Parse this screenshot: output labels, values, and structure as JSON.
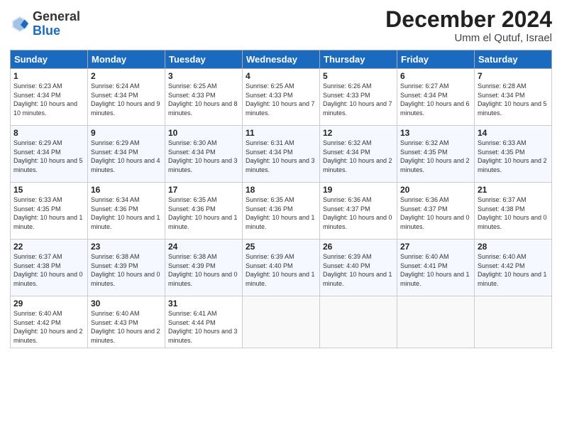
{
  "header": {
    "logo_general": "General",
    "logo_blue": "Blue",
    "month_title": "December 2024",
    "location": "Umm el Qutuf, Israel"
  },
  "days_of_week": [
    "Sunday",
    "Monday",
    "Tuesday",
    "Wednesday",
    "Thursday",
    "Friday",
    "Saturday"
  ],
  "weeks": [
    [
      {
        "day": "1",
        "sunrise": "6:23 AM",
        "sunset": "4:34 PM",
        "daylight": "10 hours and 10 minutes."
      },
      {
        "day": "2",
        "sunrise": "6:24 AM",
        "sunset": "4:34 PM",
        "daylight": "10 hours and 9 minutes."
      },
      {
        "day": "3",
        "sunrise": "6:25 AM",
        "sunset": "4:33 PM",
        "daylight": "10 hours and 8 minutes."
      },
      {
        "day": "4",
        "sunrise": "6:25 AM",
        "sunset": "4:33 PM",
        "daylight": "10 hours and 7 minutes."
      },
      {
        "day": "5",
        "sunrise": "6:26 AM",
        "sunset": "4:33 PM",
        "daylight": "10 hours and 7 minutes."
      },
      {
        "day": "6",
        "sunrise": "6:27 AM",
        "sunset": "4:34 PM",
        "daylight": "10 hours and 6 minutes."
      },
      {
        "day": "7",
        "sunrise": "6:28 AM",
        "sunset": "4:34 PM",
        "daylight": "10 hours and 5 minutes."
      }
    ],
    [
      {
        "day": "8",
        "sunrise": "6:29 AM",
        "sunset": "4:34 PM",
        "daylight": "10 hours and 5 minutes."
      },
      {
        "day": "9",
        "sunrise": "6:29 AM",
        "sunset": "4:34 PM",
        "daylight": "10 hours and 4 minutes."
      },
      {
        "day": "10",
        "sunrise": "6:30 AM",
        "sunset": "4:34 PM",
        "daylight": "10 hours and 3 minutes."
      },
      {
        "day": "11",
        "sunrise": "6:31 AM",
        "sunset": "4:34 PM",
        "daylight": "10 hours and 3 minutes."
      },
      {
        "day": "12",
        "sunrise": "6:32 AM",
        "sunset": "4:34 PM",
        "daylight": "10 hours and 2 minutes."
      },
      {
        "day": "13",
        "sunrise": "6:32 AM",
        "sunset": "4:35 PM",
        "daylight": "10 hours and 2 minutes."
      },
      {
        "day": "14",
        "sunrise": "6:33 AM",
        "sunset": "4:35 PM",
        "daylight": "10 hours and 2 minutes."
      }
    ],
    [
      {
        "day": "15",
        "sunrise": "6:33 AM",
        "sunset": "4:35 PM",
        "daylight": "10 hours and 1 minute."
      },
      {
        "day": "16",
        "sunrise": "6:34 AM",
        "sunset": "4:36 PM",
        "daylight": "10 hours and 1 minute."
      },
      {
        "day": "17",
        "sunrise": "6:35 AM",
        "sunset": "4:36 PM",
        "daylight": "10 hours and 1 minute."
      },
      {
        "day": "18",
        "sunrise": "6:35 AM",
        "sunset": "4:36 PM",
        "daylight": "10 hours and 1 minute."
      },
      {
        "day": "19",
        "sunrise": "6:36 AM",
        "sunset": "4:37 PM",
        "daylight": "10 hours and 0 minutes."
      },
      {
        "day": "20",
        "sunrise": "6:36 AM",
        "sunset": "4:37 PM",
        "daylight": "10 hours and 0 minutes."
      },
      {
        "day": "21",
        "sunrise": "6:37 AM",
        "sunset": "4:38 PM",
        "daylight": "10 hours and 0 minutes."
      }
    ],
    [
      {
        "day": "22",
        "sunrise": "6:37 AM",
        "sunset": "4:38 PM",
        "daylight": "10 hours and 0 minutes."
      },
      {
        "day": "23",
        "sunrise": "6:38 AM",
        "sunset": "4:39 PM",
        "daylight": "10 hours and 0 minutes."
      },
      {
        "day": "24",
        "sunrise": "6:38 AM",
        "sunset": "4:39 PM",
        "daylight": "10 hours and 0 minutes."
      },
      {
        "day": "25",
        "sunrise": "6:39 AM",
        "sunset": "4:40 PM",
        "daylight": "10 hours and 1 minute."
      },
      {
        "day": "26",
        "sunrise": "6:39 AM",
        "sunset": "4:40 PM",
        "daylight": "10 hours and 1 minute."
      },
      {
        "day": "27",
        "sunrise": "6:40 AM",
        "sunset": "4:41 PM",
        "daylight": "10 hours and 1 minute."
      },
      {
        "day": "28",
        "sunrise": "6:40 AM",
        "sunset": "4:42 PM",
        "daylight": "10 hours and 1 minute."
      }
    ],
    [
      {
        "day": "29",
        "sunrise": "6:40 AM",
        "sunset": "4:42 PM",
        "daylight": "10 hours and 2 minutes."
      },
      {
        "day": "30",
        "sunrise": "6:40 AM",
        "sunset": "4:43 PM",
        "daylight": "10 hours and 2 minutes."
      },
      {
        "day": "31",
        "sunrise": "6:41 AM",
        "sunset": "4:44 PM",
        "daylight": "10 hours and 3 minutes."
      },
      null,
      null,
      null,
      null
    ]
  ]
}
